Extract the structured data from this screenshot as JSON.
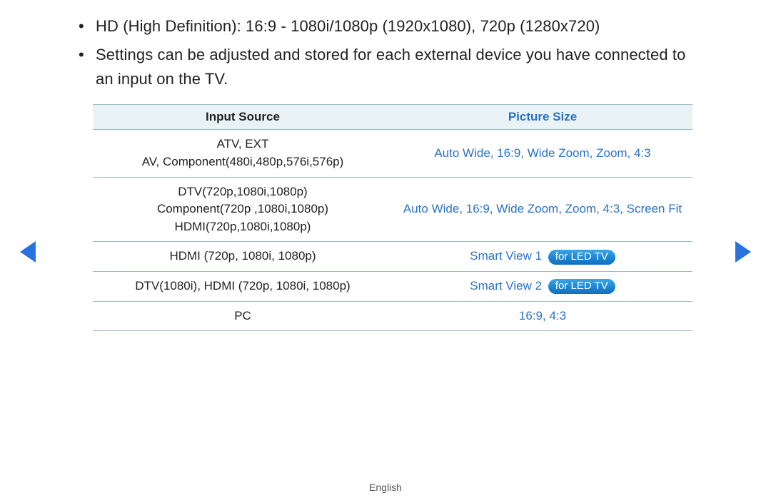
{
  "bullets": [
    "HD (High Definition): 16:9 - 1080i/1080p (1920x1080), 720p (1280x720)",
    "Settings can be adjusted and stored for each external device you have connected to an input on the TV."
  ],
  "table": {
    "headers": {
      "input": "Input Source",
      "picture": "Picture Size"
    },
    "rows": [
      {
        "src": "ATV, EXT\nAV, Component(480i,480p,576i,576p)",
        "pic": "Auto Wide, 16:9, Wide Zoom, Zoom, 4:3",
        "pill": ""
      },
      {
        "src": "DTV(720p,1080i,1080p)\nComponent(720p ,1080i,1080p)\nHDMI(720p,1080i,1080p)",
        "pic": "Auto Wide, 16:9, Wide Zoom, Zoom, 4:3, Screen Fit",
        "pill": ""
      },
      {
        "src": "HDMI (720p, 1080i, 1080p)",
        "pic": "Smart View 1",
        "pill": "for LED TV"
      },
      {
        "src": "DTV(1080i), HDMI (720p, 1080i, 1080p)",
        "pic": "Smart View 2",
        "pill": "for LED TV"
      },
      {
        "src": "PC",
        "pic": "16:9, 4:3",
        "pill": ""
      }
    ]
  },
  "footer": {
    "lang": "English"
  }
}
